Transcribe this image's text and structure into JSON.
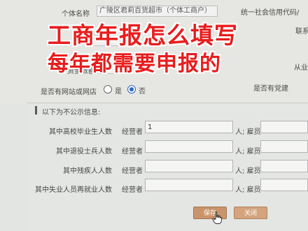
{
  "header": {
    "name_label": "个体名称",
    "company_name": "广陵区君莉百货超市（个体工商户）",
    "credit_code_label": "统一社会信用代码/",
    "partial_right_1": "联系",
    "partial_right_2": "从业",
    "partial_left": "资金数额"
  },
  "overlay": {
    "line1": "工商年报怎么填写",
    "line2": "每年都需要申报的"
  },
  "website": {
    "label": "是否有网站或网店",
    "option_yes": "是",
    "option_no": "否",
    "selected": "否",
    "right_label": "是否有党建"
  },
  "section": {
    "title": "以下为不公示信息:",
    "operator_label": "经营者",
    "employee_label": "人; 雇员",
    "rows": [
      {
        "label": "其中高校毕业生人数",
        "operator_value": "1",
        "employee_value": ""
      },
      {
        "label": "其中退役士兵人数",
        "operator_value": "",
        "employee_value": ""
      },
      {
        "label": "其中残疾人人数",
        "operator_value": "",
        "employee_value": ""
      },
      {
        "label": "其中失业人员再就业人数",
        "operator_value": "",
        "employee_value": ""
      }
    ]
  },
  "actions": {
    "save_label": "保存",
    "close_label": "关闭"
  },
  "colors": {
    "headline": "#e81d1d",
    "radio_selected": "#2b64c8",
    "save_button": "#c9946b",
    "close_button": "#d3a47e"
  }
}
